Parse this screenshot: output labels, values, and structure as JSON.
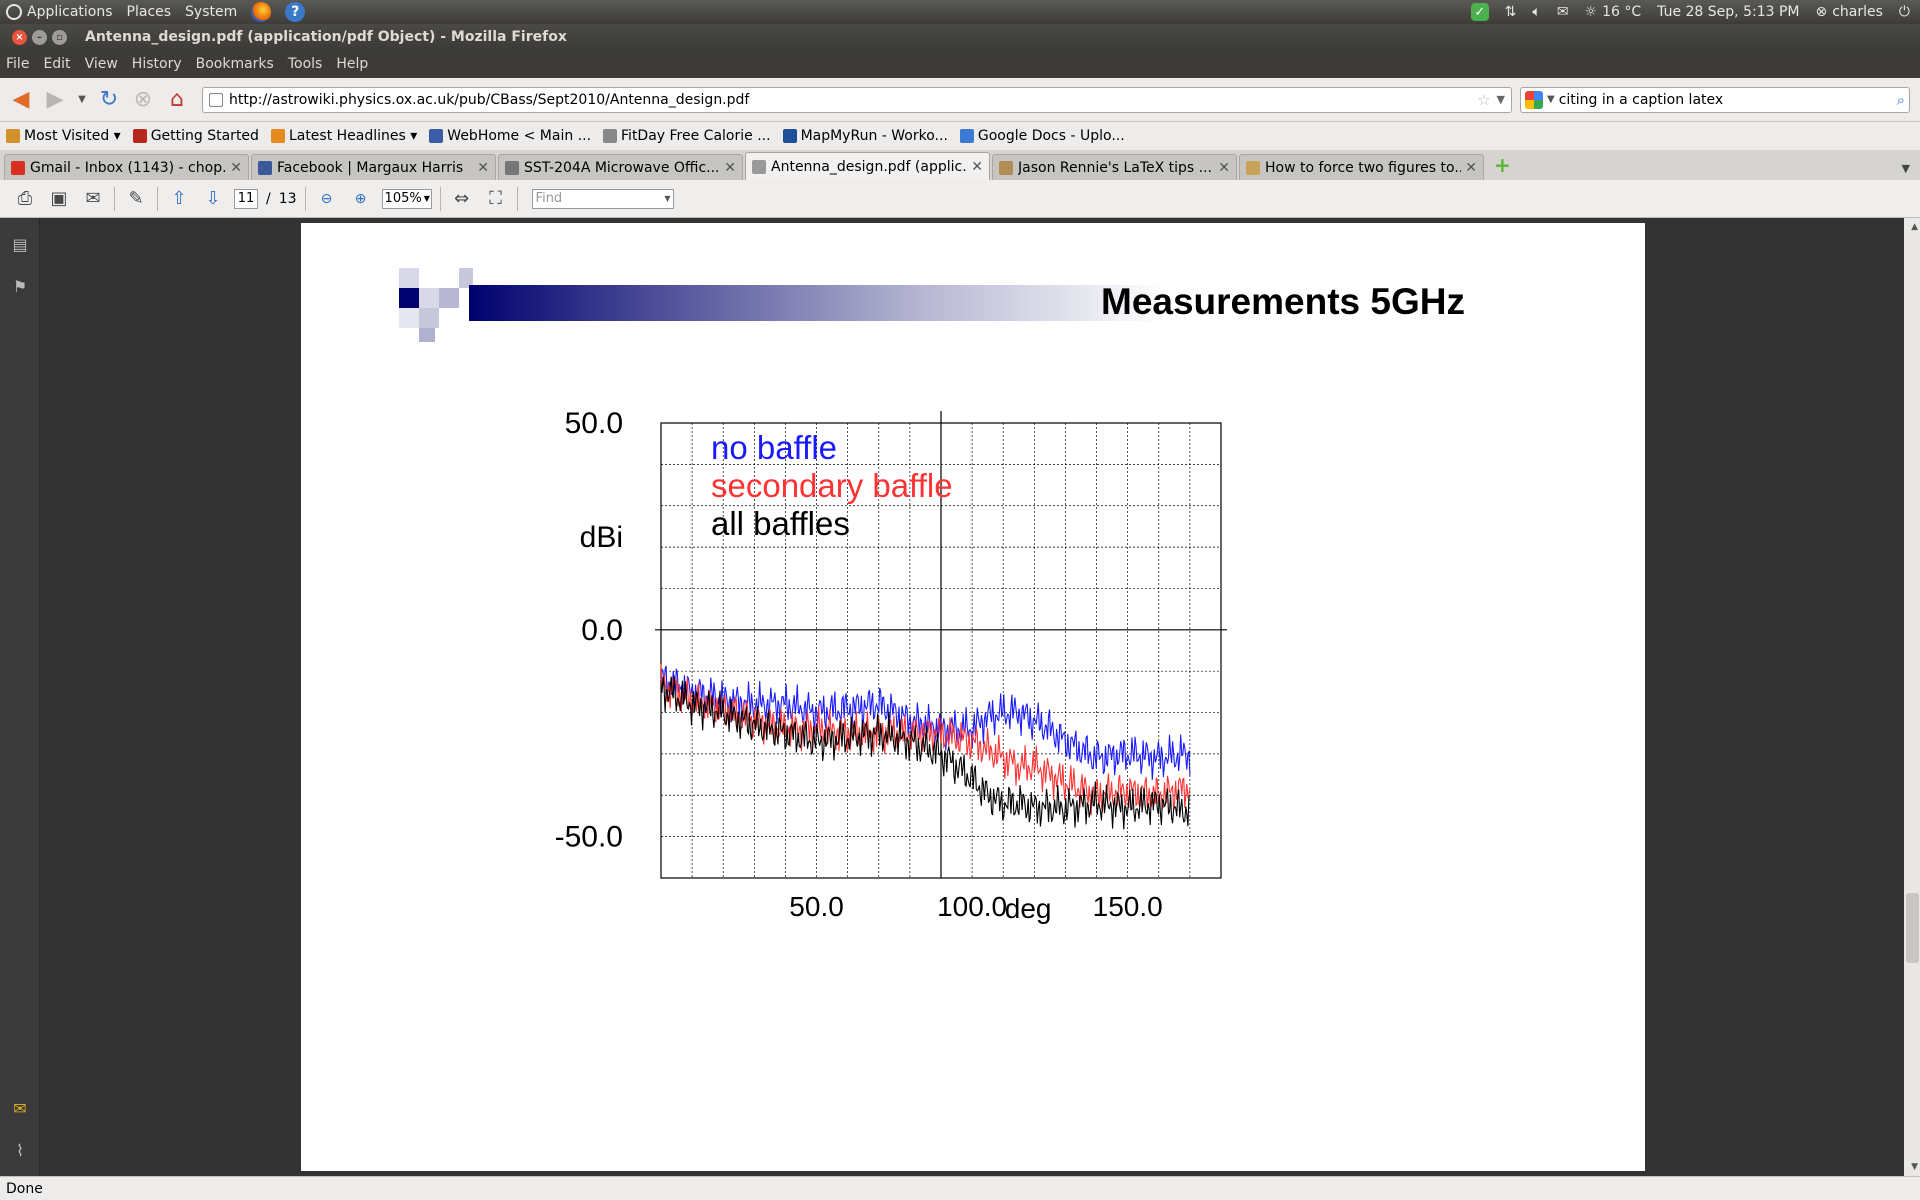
{
  "panel": {
    "applications": "Applications",
    "places": "Places",
    "system": "System",
    "temperature": "16 °C",
    "datetime": "Tue 28 Sep,  5:13 PM",
    "user": "charles"
  },
  "window": {
    "title": "Antenna_design.pdf (application/pdf Object) - Mozilla Firefox"
  },
  "menu": [
    "File",
    "Edit",
    "View",
    "History",
    "Bookmarks",
    "Tools",
    "Help"
  ],
  "nav": {
    "url": "http://astrowiki.physics.ox.ac.uk/pub/CBass/Sept2010/Antenna_design.pdf",
    "search_value": "citing in a caption latex"
  },
  "bookmarks": [
    {
      "label": "Most Visited ▾",
      "color": "#d4902a"
    },
    {
      "label": "Getting Started",
      "color": "#b5281c"
    },
    {
      "label": "Latest Headlines ▾",
      "color": "#e58a1f"
    },
    {
      "label": "WebHome < Main ...",
      "color": "#3a5da8"
    },
    {
      "label": "FitDay Free Calorie ...",
      "color": "#888888"
    },
    {
      "label": "MapMyRun - Worko...",
      "color": "#1d4f9c"
    },
    {
      "label": "Google Docs - Uplo...",
      "color": "#3b7bd4"
    }
  ],
  "tabs": [
    {
      "label": "Gmail - Inbox (1143) - chop...",
      "color": "#d93025"
    },
    {
      "label": "Facebook | Margaux Harris",
      "color": "#3b5998"
    },
    {
      "label": "SST-204A Microwave Offic...",
      "color": "#777777"
    },
    {
      "label": "Antenna_design.pdf (applic...",
      "color": "#999999"
    },
    {
      "label": "Jason Rennie's LaTeX tips ...",
      "color": "#b08d57"
    },
    {
      "label": "How to force two figures to...",
      "color": "#c9a25a"
    }
  ],
  "pdf_toolbar": {
    "page_current": "11",
    "page_sep": "/",
    "page_total": "13",
    "zoom": "105%",
    "find_placeholder": "Find"
  },
  "slide": {
    "title": "Measurements 5GHz"
  },
  "chart_data": {
    "type": "line",
    "title": "",
    "xlabel": "deg",
    "ylabel": "dBi",
    "xlim": [
      0,
      180
    ],
    "ylim": [
      -60,
      50
    ],
    "x_ticks": [
      50.0,
      100.0,
      150.0
    ],
    "x_tick_labels": [
      "50.0",
      "100.0",
      "150.0"
    ],
    "y_ticks": [
      50.0,
      0.0,
      -50.0
    ],
    "y_tick_labels": [
      "50.0",
      "0.0",
      "-50.0"
    ],
    "grid": true,
    "legend_position": "top-left",
    "series": [
      {
        "name": "no baffle",
        "color": "#1a1aff",
        "x": [
          0,
          10,
          20,
          30,
          40,
          50,
          60,
          70,
          80,
          90,
          100,
          105,
          110,
          115,
          120,
          125,
          130,
          140,
          150,
          160,
          170
        ],
        "y": [
          -12,
          -15,
          -17,
          -18,
          -18,
          -20,
          -19,
          -18,
          -22,
          -24,
          -24,
          -21,
          -20,
          -20,
          -22,
          -24,
          -27,
          -31,
          -30,
          -31,
          -30
        ]
      },
      {
        "name": "secondary baffle",
        "color": "#ff3333",
        "x": [
          0,
          10,
          20,
          30,
          40,
          50,
          60,
          70,
          80,
          90,
          100,
          105,
          110,
          115,
          120,
          125,
          130,
          140,
          150,
          160,
          170
        ],
        "y": [
          -13,
          -17,
          -19,
          -22,
          -24,
          -24,
          -25,
          -25,
          -25,
          -25,
          -27,
          -29,
          -31,
          -33,
          -33,
          -35,
          -37,
          -40,
          -39,
          -40,
          -38
        ]
      },
      {
        "name": "all baffles",
        "color": "#000000",
        "x": [
          0,
          10,
          20,
          30,
          40,
          50,
          60,
          70,
          80,
          90,
          100,
          105,
          110,
          115,
          120,
          125,
          130,
          140,
          150,
          160,
          170
        ],
        "y": [
          -14,
          -18,
          -20,
          -23,
          -25,
          -27,
          -26,
          -25,
          -27,
          -30,
          -36,
          -40,
          -42,
          -42,
          -43,
          -43,
          -43,
          -42,
          -43,
          -42,
          -44
        ]
      }
    ]
  },
  "status": {
    "text": "Done"
  },
  "colors": {
    "panel_bg": "#3c3b37",
    "viewer_bg": "#333333",
    "band_dark": "#00006e"
  }
}
